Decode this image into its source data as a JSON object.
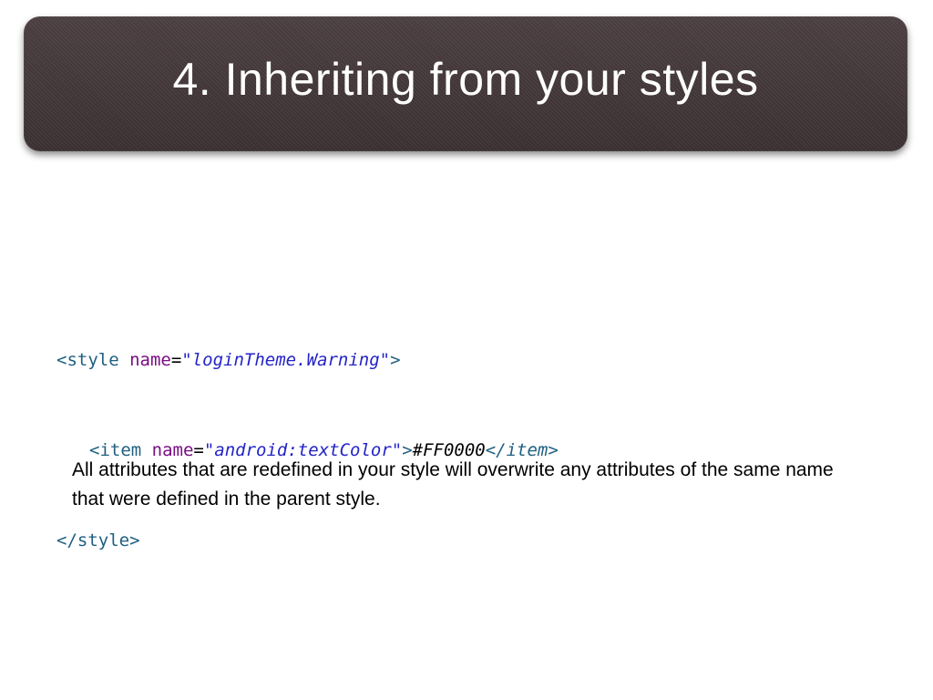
{
  "slide": {
    "title": "4. Inheriting from your styles"
  },
  "code": {
    "line1": {
      "open": "<style ",
      "attr": "name",
      "eq": "=",
      "value": "\"loginTheme.Warning\"",
      "close": ">"
    },
    "line2": {
      "open": "<item ",
      "attr": "name",
      "eq": "=",
      "value": "\"android:textColor\"",
      "close": ">",
      "text": "#FF0000",
      "end": "</item>"
    },
    "line3": {
      "end": "</style>"
    }
  },
  "body": {
    "paragraph": "All attributes that are redefined in your style will overwrite any attributes of the same name that were defined in the parent style."
  },
  "colors": {
    "banner": "#3f3436",
    "tag": "#1f5f80",
    "attribute": "#7a0d84",
    "value": "#2424c8"
  }
}
